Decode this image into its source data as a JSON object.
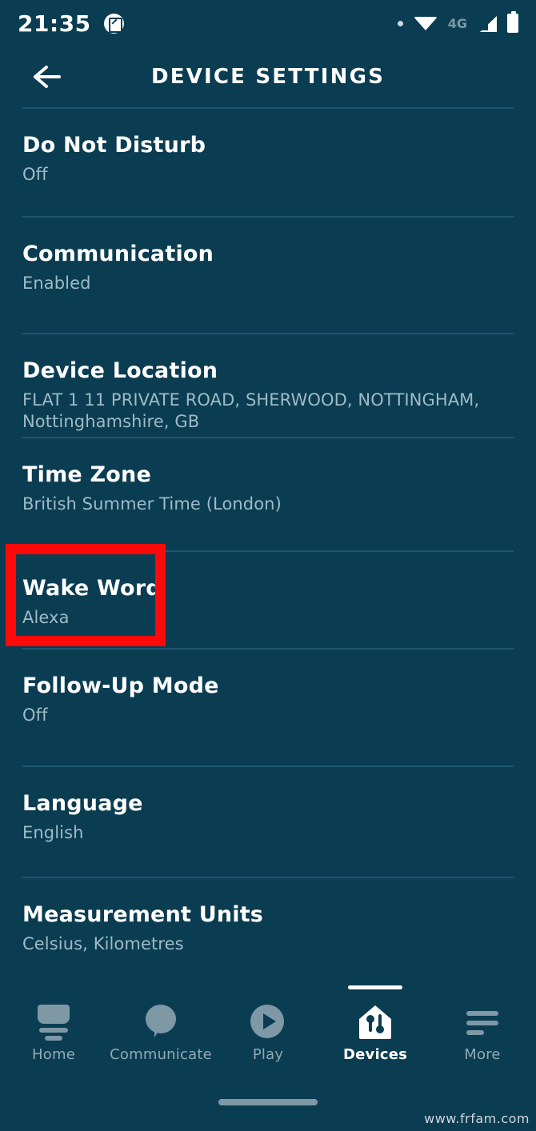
{
  "status_bar": {
    "time": "21:35",
    "notification_icon": "screenshot-icon",
    "dot_icon": "dot-indicator-icon",
    "wifi_icon": "wifi-icon",
    "network_type": "4G",
    "signal_icon": "cellular-signal-icon",
    "battery_icon": "battery-full-icon"
  },
  "header": {
    "back_icon": "back-arrow-icon",
    "title": "DEVICE SETTINGS"
  },
  "settings": [
    {
      "title": "Do Not Disturb",
      "value": "Off"
    },
    {
      "title": "Communication",
      "value": "Enabled"
    },
    {
      "title": "Device Location",
      "value": "FLAT 1 11 PRIVATE ROAD, SHERWOOD, NOTTINGHAM, Nottinghamshire, GB"
    },
    {
      "title": "Time Zone",
      "value": "British Summer Time (London)"
    },
    {
      "title": "Wake Word",
      "value": "Alexa"
    },
    {
      "title": "Follow-Up Mode",
      "value": "Off"
    },
    {
      "title": "Language",
      "value": "English"
    },
    {
      "title": "Measurement Units",
      "value": "Celsius, Kilometres"
    }
  ],
  "highlight": {
    "target": "Wake Word",
    "color": "#fb0a09"
  },
  "bottom_nav": {
    "items": [
      {
        "label": "Home",
        "icon": "echo-device-icon",
        "active": false
      },
      {
        "label": "Communicate",
        "icon": "speech-bubble-icon",
        "active": false
      },
      {
        "label": "Play",
        "icon": "play-circle-icon",
        "active": false
      },
      {
        "label": "Devices",
        "icon": "home-devices-icon",
        "active": true
      },
      {
        "label": "More",
        "icon": "hamburger-menu-icon",
        "active": false
      }
    ]
  },
  "watermark": "www.frfam.com",
  "colors": {
    "background": "#0b3d52",
    "title_text": "#ffffff",
    "subtitle_text": "#9fbac7",
    "divider": "#1d5771",
    "inactive_nav": "#8fa9b6",
    "highlight": "#fb0a09"
  }
}
